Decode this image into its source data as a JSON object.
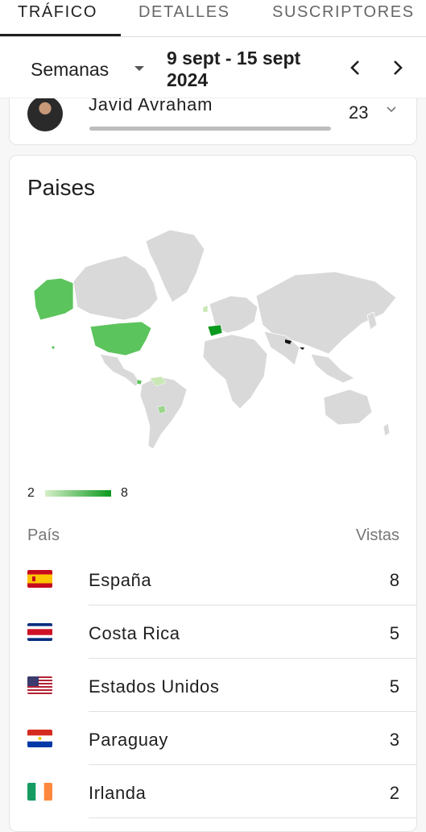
{
  "tabs": [
    "TRÁFICO",
    "DETALLES",
    "SUSCRIPTORES"
  ],
  "date_bar": {
    "period": "Semanas",
    "range_line1": "9 sept - 15 sept",
    "range_line2": "2024"
  },
  "subscriber": {
    "name": "Javid Avraham",
    "count": "23"
  },
  "countries_card": {
    "title": "Paises",
    "legend_min": "2",
    "legend_max": "8",
    "col_country": "País",
    "col_views": "Vistas",
    "rows": [
      {
        "name": "España",
        "value": "8",
        "flag": "spain"
      },
      {
        "name": "Costa Rica",
        "value": "5",
        "flag": "costa-rica"
      },
      {
        "name": "Estados Unidos",
        "value": "5",
        "flag": "usa"
      },
      {
        "name": "Paraguay",
        "value": "3",
        "flag": "paraguay"
      },
      {
        "name": "Irlanda",
        "value": "2",
        "flag": "ireland"
      }
    ]
  },
  "colors": {
    "map_high": "#0a9a1e",
    "map_mid": "#5cc45c",
    "map_low": "#c9e8b5",
    "land": "#d9d9d9"
  }
}
